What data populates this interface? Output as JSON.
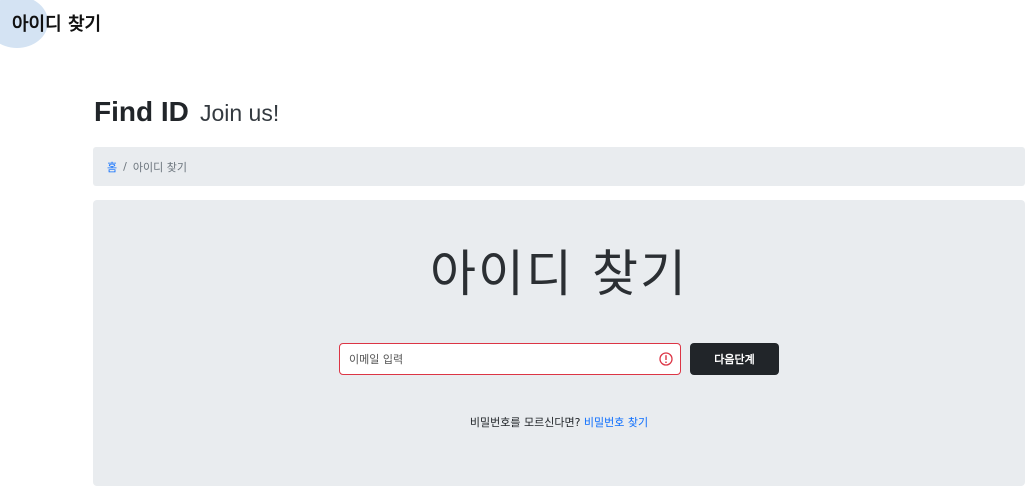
{
  "top_title": "아이디 찾기",
  "heading": {
    "main": "Find ID",
    "sub": "Join us!"
  },
  "breadcrumb": {
    "home": "홈",
    "separator": "/",
    "current": "아이디 찾기"
  },
  "main": {
    "title": "아이디 찾기",
    "email_placeholder": "이메일 입력",
    "email_value": "",
    "next_button": "다음단계",
    "hint_text": "비밀번호를 모르신다면? ",
    "hint_link": "비밀번호 찾기"
  },
  "colors": {
    "accent": "#0d6efd",
    "invalid": "#dc3545",
    "button_bg": "#212529",
    "panel_bg": "#e9ecef"
  }
}
